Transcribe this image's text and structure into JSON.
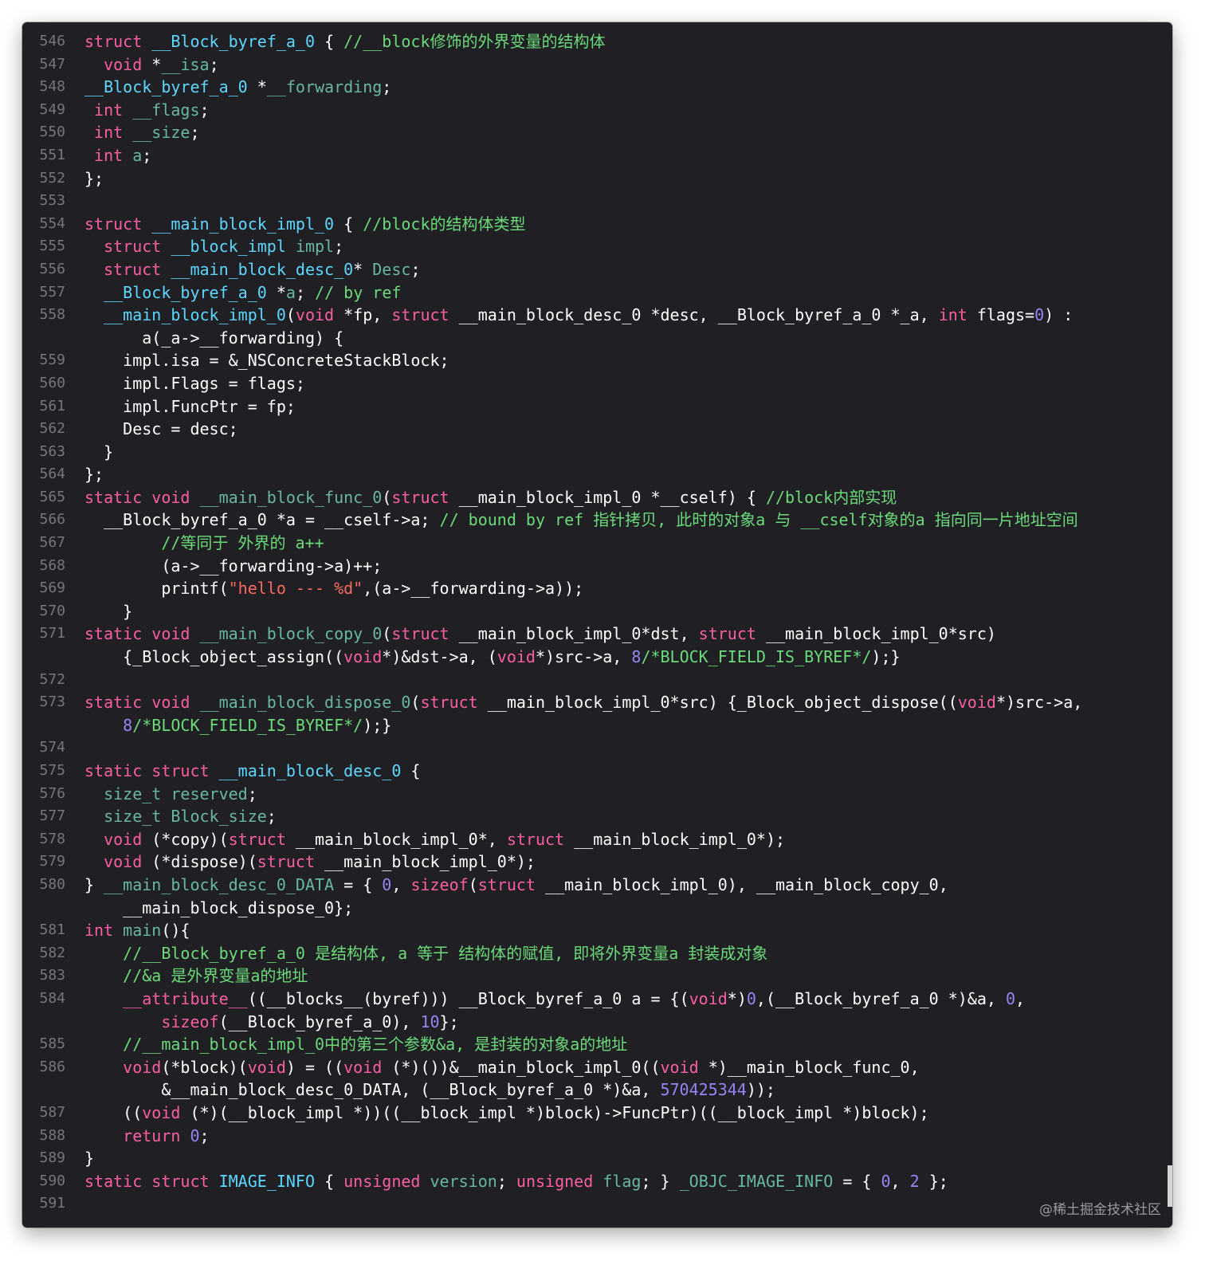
{
  "window": {
    "theme_bg": "#1f1f24",
    "colors": {
      "keyword": "#fc5fa3",
      "type": "#5dd8ff",
      "comment": "#6bdb7a",
      "string": "#fc6a5d",
      "number": "#9686f5",
      "function": "#67b7a4",
      "plain": "#ffffff"
    }
  },
  "watermark": "@稀土掘金技术社区",
  "lines": [
    {
      "n": "546",
      "parts": [
        [
          "k",
          "struct "
        ],
        [
          "t",
          "__Block_byref_a_0"
        ],
        [
          "p",
          " { "
        ],
        [
          "c",
          "//__block修饰的外界变量的结构体"
        ]
      ]
    },
    {
      "n": "547",
      "parts": [
        [
          "p",
          "  "
        ],
        [
          "k",
          "void"
        ],
        [
          "p",
          " *"
        ],
        [
          "f",
          "__isa"
        ],
        [
          "p",
          ";"
        ]
      ]
    },
    {
      "n": "548",
      "parts": [
        [
          "t",
          "__Block_byref_a_0"
        ],
        [
          "p",
          " *"
        ],
        [
          "f",
          "__forwarding"
        ],
        [
          "p",
          ";"
        ]
      ]
    },
    {
      "n": "549",
      "parts": [
        [
          "p",
          " "
        ],
        [
          "k",
          "int"
        ],
        [
          "p",
          " "
        ],
        [
          "f",
          "__flags"
        ],
        [
          "p",
          ";"
        ]
      ]
    },
    {
      "n": "550",
      "parts": [
        [
          "p",
          " "
        ],
        [
          "k",
          "int"
        ],
        [
          "p",
          " "
        ],
        [
          "f",
          "__size"
        ],
        [
          "p",
          ";"
        ]
      ]
    },
    {
      "n": "551",
      "parts": [
        [
          "p",
          " "
        ],
        [
          "k",
          "int"
        ],
        [
          "p",
          " "
        ],
        [
          "f",
          "a"
        ],
        [
          "p",
          ";"
        ]
      ]
    },
    {
      "n": "552",
      "parts": [
        [
          "p",
          "};"
        ]
      ]
    },
    {
      "n": "553",
      "parts": []
    },
    {
      "n": "554",
      "parts": [
        [
          "k",
          "struct "
        ],
        [
          "t",
          "__main_block_impl_0"
        ],
        [
          "p",
          " { "
        ],
        [
          "c",
          "//block的结构体类型"
        ]
      ]
    },
    {
      "n": "555",
      "parts": [
        [
          "p",
          "  "
        ],
        [
          "k",
          "struct "
        ],
        [
          "t",
          "__block_impl"
        ],
        [
          "p",
          " "
        ],
        [
          "f",
          "impl"
        ],
        [
          "p",
          ";"
        ]
      ]
    },
    {
      "n": "556",
      "parts": [
        [
          "p",
          "  "
        ],
        [
          "k",
          "struct "
        ],
        [
          "t",
          "__main_block_desc_0"
        ],
        [
          "p",
          "* "
        ],
        [
          "f",
          "Desc"
        ],
        [
          "p",
          ";"
        ]
      ]
    },
    {
      "n": "557",
      "parts": [
        [
          "p",
          "  "
        ],
        [
          "t",
          "__Block_byref_a_0"
        ],
        [
          "p",
          " *"
        ],
        [
          "f",
          "a"
        ],
        [
          "p",
          "; "
        ],
        [
          "c",
          "// by ref"
        ]
      ]
    },
    {
      "n": "558",
      "wrap": true,
      "parts": [
        [
          "p",
          "  "
        ],
        [
          "t",
          "__main_block_impl_0"
        ],
        [
          "p",
          "("
        ],
        [
          "k",
          "void"
        ],
        [
          "p",
          " *fp, "
        ],
        [
          "k",
          "struct"
        ],
        [
          "p",
          " __main_block_desc_0 *desc, __Block_byref_a_0 *_a, "
        ],
        [
          "k",
          "int"
        ],
        [
          "p",
          " flags="
        ],
        [
          "n",
          "0"
        ],
        [
          "p",
          ") :\n      a(_a->__forwarding) {"
        ]
      ]
    },
    {
      "n": "559",
      "parts": [
        [
          "p",
          "    impl.isa = &_NSConcreteStackBlock;"
        ]
      ]
    },
    {
      "n": "560",
      "parts": [
        [
          "p",
          "    impl.Flags = flags;"
        ]
      ]
    },
    {
      "n": "561",
      "parts": [
        [
          "p",
          "    impl.FuncPtr = fp;"
        ]
      ]
    },
    {
      "n": "562",
      "parts": [
        [
          "p",
          "    Desc = desc;"
        ]
      ]
    },
    {
      "n": "563",
      "parts": [
        [
          "p",
          "  }"
        ]
      ]
    },
    {
      "n": "564",
      "parts": [
        [
          "p",
          "};"
        ]
      ]
    },
    {
      "n": "565",
      "parts": [
        [
          "k",
          "static void"
        ],
        [
          "p",
          " "
        ],
        [
          "f",
          "__main_block_func_0"
        ],
        [
          "p",
          "("
        ],
        [
          "k",
          "struct"
        ],
        [
          "p",
          " __main_block_impl_0 *__cself) { "
        ],
        [
          "c",
          "//block内部实现"
        ]
      ]
    },
    {
      "n": "566",
      "parts": [
        [
          "p",
          "  __Block_byref_a_0 *a = __cself->a; "
        ],
        [
          "c",
          "// bound by ref 指针拷贝, 此时的对象a 与 __cself对象的a 指向同一片地址空间"
        ]
      ]
    },
    {
      "n": "567",
      "parts": [
        [
          "p",
          "        "
        ],
        [
          "c",
          "//等同于 外界的 a++"
        ]
      ]
    },
    {
      "n": "568",
      "parts": [
        [
          "p",
          "        (a->__forwarding->a)++;"
        ]
      ]
    },
    {
      "n": "569",
      "parts": [
        [
          "p",
          "        printf("
        ],
        [
          "s",
          "\"hello --- %d\""
        ],
        [
          "p",
          ",(a->__forwarding->a));"
        ]
      ]
    },
    {
      "n": "570",
      "parts": [
        [
          "p",
          "    }"
        ]
      ]
    },
    {
      "n": "571",
      "wrap": true,
      "parts": [
        [
          "k",
          "static void"
        ],
        [
          "p",
          " "
        ],
        [
          "f",
          "__main_block_copy_0"
        ],
        [
          "p",
          "("
        ],
        [
          "k",
          "struct"
        ],
        [
          "p",
          " __main_block_impl_0*dst, "
        ],
        [
          "k",
          "struct"
        ],
        [
          "p",
          " __main_block_impl_0*src)\n    {_Block_object_assign(("
        ],
        [
          "k",
          "void"
        ],
        [
          "p",
          "*)&dst->a, ("
        ],
        [
          "k",
          "void"
        ],
        [
          "p",
          "*)src->a, "
        ],
        [
          "n",
          "8"
        ],
        [
          "c",
          "/*BLOCK_FIELD_IS_BYREF*/"
        ],
        [
          "p",
          ");}"
        ]
      ]
    },
    {
      "n": "572",
      "parts": []
    },
    {
      "n": "573",
      "wrap": true,
      "parts": [
        [
          "k",
          "static void"
        ],
        [
          "p",
          " "
        ],
        [
          "f",
          "__main_block_dispose_0"
        ],
        [
          "p",
          "("
        ],
        [
          "k",
          "struct"
        ],
        [
          "p",
          " __main_block_impl_0*src) {_Block_object_dispose(("
        ],
        [
          "k",
          "void"
        ],
        [
          "p",
          "*)src->a,\n    "
        ],
        [
          "n",
          "8"
        ],
        [
          "c",
          "/*BLOCK_FIELD_IS_BYREF*/"
        ],
        [
          "p",
          ");}"
        ]
      ]
    },
    {
      "n": "574",
      "parts": []
    },
    {
      "n": "575",
      "parts": [
        [
          "k",
          "static struct"
        ],
        [
          "p",
          " "
        ],
        [
          "t",
          "__main_block_desc_0"
        ],
        [
          "p",
          " {"
        ]
      ]
    },
    {
      "n": "576",
      "parts": [
        [
          "p",
          "  "
        ],
        [
          "f",
          "size_t reserved"
        ],
        [
          "p",
          ";"
        ]
      ]
    },
    {
      "n": "577",
      "parts": [
        [
          "p",
          "  "
        ],
        [
          "f",
          "size_t Block_size"
        ],
        [
          "p",
          ";"
        ]
      ]
    },
    {
      "n": "578",
      "parts": [
        [
          "p",
          "  "
        ],
        [
          "k",
          "void"
        ],
        [
          "p",
          " (*copy)("
        ],
        [
          "k",
          "struct"
        ],
        [
          "p",
          " __main_block_impl_0*, "
        ],
        [
          "k",
          "struct"
        ],
        [
          "p",
          " __main_block_impl_0*);"
        ]
      ]
    },
    {
      "n": "579",
      "parts": [
        [
          "p",
          "  "
        ],
        [
          "k",
          "void"
        ],
        [
          "p",
          " (*dispose)("
        ],
        [
          "k",
          "struct"
        ],
        [
          "p",
          " __main_block_impl_0*);"
        ]
      ]
    },
    {
      "n": "580",
      "wrap": true,
      "parts": [
        [
          "p",
          "} "
        ],
        [
          "f",
          "__main_block_desc_0_DATA"
        ],
        [
          "p",
          " = { "
        ],
        [
          "n",
          "0"
        ],
        [
          "p",
          ", "
        ],
        [
          "k",
          "sizeof"
        ],
        [
          "p",
          "("
        ],
        [
          "k",
          "struct"
        ],
        [
          "p",
          " __main_block_impl_0), __main_block_copy_0,\n    __main_block_dispose_0};"
        ]
      ]
    },
    {
      "n": "581",
      "parts": [
        [
          "k",
          "int"
        ],
        [
          "p",
          " "
        ],
        [
          "f",
          "main"
        ],
        [
          "p",
          "(){"
        ]
      ]
    },
    {
      "n": "582",
      "parts": [
        [
          "p",
          "    "
        ],
        [
          "c",
          "//__Block_byref_a_0 是结构体, a 等于 结构体的赋值, 即将外界变量a 封装成对象"
        ]
      ]
    },
    {
      "n": "583",
      "parts": [
        [
          "p",
          "    "
        ],
        [
          "c",
          "//&a 是外界变量a的地址"
        ]
      ]
    },
    {
      "n": "584",
      "wrap": true,
      "parts": [
        [
          "p",
          "    "
        ],
        [
          "k",
          "__attribute__"
        ],
        [
          "p",
          "((__blocks__(byref))) __Block_byref_a_0 a = {("
        ],
        [
          "k",
          "void"
        ],
        [
          "p",
          "*)"
        ],
        [
          "n",
          "0"
        ],
        [
          "p",
          ",(__Block_byref_a_0 *)&a, "
        ],
        [
          "n",
          "0"
        ],
        [
          "p",
          ",\n        "
        ],
        [
          "k",
          "sizeof"
        ],
        [
          "p",
          "(__Block_byref_a_0), "
        ],
        [
          "n",
          "10"
        ],
        [
          "p",
          "};"
        ]
      ]
    },
    {
      "n": "585",
      "parts": [
        [
          "p",
          "    "
        ],
        [
          "c",
          "//__main_block_impl_0中的第三个参数&a, 是封装的对象a的地址"
        ]
      ]
    },
    {
      "n": "586",
      "wrap": true,
      "parts": [
        [
          "p",
          "    "
        ],
        [
          "k",
          "void"
        ],
        [
          "p",
          "(*block)("
        ],
        [
          "k",
          "void"
        ],
        [
          "p",
          ") = (("
        ],
        [
          "k",
          "void"
        ],
        [
          "p",
          " (*)())&__main_block_impl_0(("
        ],
        [
          "k",
          "void"
        ],
        [
          "p",
          " *)__main_block_func_0,\n        &__main_block_desc_0_DATA, (__Block_byref_a_0 *)&a, "
        ],
        [
          "n",
          "570425344"
        ],
        [
          "p",
          "));"
        ]
      ]
    },
    {
      "n": "587",
      "parts": [
        [
          "p",
          "    (("
        ],
        [
          "k",
          "void"
        ],
        [
          "p",
          " (*)(__block_impl *))((__block_impl *)block)->FuncPtr)((__block_impl *)block);"
        ]
      ]
    },
    {
      "n": "588",
      "parts": [
        [
          "p",
          "    "
        ],
        [
          "k",
          "return"
        ],
        [
          "p",
          " "
        ],
        [
          "n",
          "0"
        ],
        [
          "p",
          ";"
        ]
      ]
    },
    {
      "n": "589",
      "parts": [
        [
          "p",
          "}"
        ]
      ]
    },
    {
      "n": "590",
      "parts": [
        [
          "k",
          "static struct"
        ],
        [
          "p",
          " "
        ],
        [
          "t",
          "IMAGE_INFO"
        ],
        [
          "p",
          " { "
        ],
        [
          "k",
          "unsigned"
        ],
        [
          "p",
          " "
        ],
        [
          "f",
          "version"
        ],
        [
          "p",
          "; "
        ],
        [
          "k",
          "unsigned"
        ],
        [
          "p",
          " "
        ],
        [
          "f",
          "flag"
        ],
        [
          "p",
          "; } "
        ],
        [
          "f",
          "_OBJC_IMAGE_INFO"
        ],
        [
          "p",
          " = { "
        ],
        [
          "n",
          "0"
        ],
        [
          "p",
          ", "
        ],
        [
          "n",
          "2"
        ],
        [
          "p",
          " };"
        ]
      ]
    },
    {
      "n": "591",
      "parts": []
    }
  ]
}
